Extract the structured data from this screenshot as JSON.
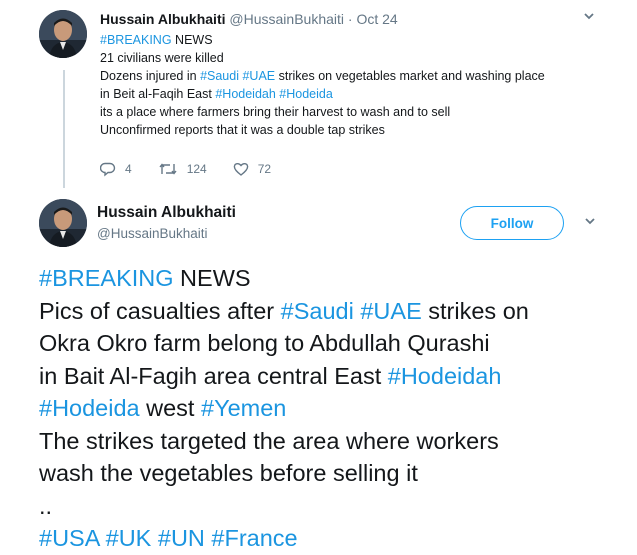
{
  "tweet1": {
    "author_name": "Hussain Albukhaiti",
    "handle": "@HussainBukhaiti",
    "separator": "·",
    "date": "Oct 24",
    "lines": [
      [
        {
          "t": "#BREAKING",
          "tag": true
        },
        {
          "t": " NEWS"
        }
      ],
      [
        {
          "t": "21 civilians were killed"
        }
      ],
      [
        {
          "t": "Dozens injured in "
        },
        {
          "t": "#Saudi",
          "tag": true
        },
        {
          "t": " "
        },
        {
          "t": "#UAE",
          "tag": true
        },
        {
          "t": " strikes on vegetables market and washing place"
        }
      ],
      [
        {
          "t": "in Beit al-Faqih East "
        },
        {
          "t": "#Hodeidah",
          "tag": true
        },
        {
          "t": " "
        },
        {
          "t": "#Hodeida",
          "tag": true
        }
      ],
      [
        {
          "t": "its a place where farmers bring their harvest to wash and to sell"
        }
      ],
      [
        {
          "t": "Unconfirmed reports that it was a double tap strikes"
        }
      ]
    ],
    "reply_count": "4",
    "retweet_count": "124",
    "like_count": "72"
  },
  "tweet2": {
    "author_name": "Hussain Albukhaiti",
    "handle": "@HussainBukhaiti",
    "follow_label": "Follow",
    "lines": [
      [
        {
          "t": "#BREAKING",
          "tag": true
        },
        {
          "t": " NEWS"
        }
      ],
      [
        {
          "t": "Pics of casualties after "
        },
        {
          "t": "#Saudi",
          "tag": true
        },
        {
          "t": " "
        },
        {
          "t": "#UAE",
          "tag": true
        },
        {
          "t": " strikes on"
        }
      ],
      [
        {
          "t": "Okra Okro farm belong to Abdullah Qurashi"
        }
      ],
      [
        {
          "t": "in Bait Al-Fagih area central East "
        },
        {
          "t": "#Hodeidah",
          "tag": true
        }
      ],
      [
        {
          "t": "#Hodeida",
          "tag": true
        },
        {
          "t": " west "
        },
        {
          "t": "#Yemen",
          "tag": true
        }
      ],
      [
        {
          "t": "The strikes targeted the area where workers"
        }
      ],
      [
        {
          "t": "wash the vegetables before  selling it"
        }
      ],
      [
        {
          "t": ".."
        }
      ],
      [
        {
          "t": "#USA",
          "tag": true
        },
        {
          "t": " "
        },
        {
          "t": "#UK",
          "tag": true
        },
        {
          "t": " "
        },
        {
          "t": "#UN",
          "tag": true
        },
        {
          "t": " "
        },
        {
          "t": "#France",
          "tag": true
        }
      ]
    ]
  },
  "colors": {
    "link": "#1b95e0",
    "follow": "#1da1f2",
    "muted": "#657786",
    "thread_line": "#ccd6dd"
  },
  "icons": {
    "reply": "reply-icon",
    "retweet": "retweet-icon",
    "like": "heart-icon",
    "more": "chevron-down-icon"
  }
}
